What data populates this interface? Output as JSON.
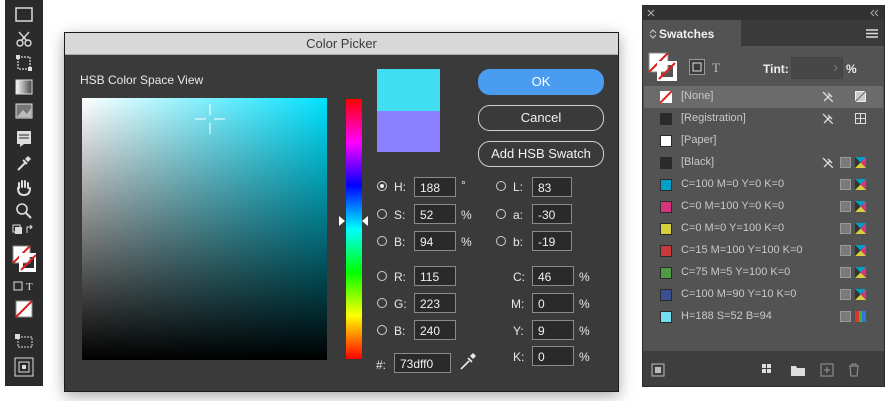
{
  "dialog": {
    "title": "Color Picker",
    "space_label": "HSB Color Space View",
    "current_color": "#41ddf0",
    "previous_color": "#8b80ff",
    "buttons": {
      "ok": "OK",
      "cancel": "Cancel",
      "add": "Add HSB Swatch"
    },
    "hsb": {
      "h": {
        "label": "H:",
        "value": "188",
        "unit": "°"
      },
      "s": {
        "label": "S:",
        "value": "52",
        "unit": "%"
      },
      "b": {
        "label": "B:",
        "value": "94",
        "unit": "%"
      }
    },
    "lab": {
      "l": {
        "label": "L:",
        "value": "83"
      },
      "a": {
        "label": "a:",
        "value": "-30"
      },
      "b": {
        "label": "b:",
        "value": "-19"
      }
    },
    "rgb": {
      "r": {
        "label": "R:",
        "value": "115"
      },
      "g": {
        "label": "G:",
        "value": "223"
      },
      "b": {
        "label": "B:",
        "value": "240"
      }
    },
    "cmyk": {
      "c": {
        "label": "C:",
        "value": "46",
        "unit": "%"
      },
      "m": {
        "label": "M:",
        "value": "0",
        "unit": "%"
      },
      "y": {
        "label": "Y:",
        "value": "9",
        "unit": "%"
      },
      "k": {
        "label": "K:",
        "value": "0",
        "unit": "%"
      }
    },
    "hex": {
      "label": "#:",
      "value": "73dff0"
    }
  },
  "panel": {
    "title": "Swatches",
    "tint_label": "Tint:",
    "tint_unit": "%",
    "swatches": [
      {
        "name": "[None]",
        "color": "#ffffff"
      },
      {
        "name": "[Registration]",
        "color": "#2b2b2b"
      },
      {
        "name": "[Paper]",
        "color": "#ffffff"
      },
      {
        "name": "[Black]",
        "color": "#2b2b2b"
      },
      {
        "name": "C=100 M=0 Y=0 K=0",
        "color": "#00a0c6"
      },
      {
        "name": "C=0 M=100 Y=0 K=0",
        "color": "#d6347d"
      },
      {
        "name": "C=0 M=0 Y=100 K=0",
        "color": "#d7d03a"
      },
      {
        "name": "C=15 M=100 Y=100 K=0",
        "color": "#c8393b"
      },
      {
        "name": "C=75 M=5 Y=100 K=0",
        "color": "#4f9a45"
      },
      {
        "name": "C=100 M=90 Y=10 K=0",
        "color": "#3d4f93"
      },
      {
        "name": "H=188 S=52 B=94",
        "color": "#73dff0"
      }
    ]
  }
}
